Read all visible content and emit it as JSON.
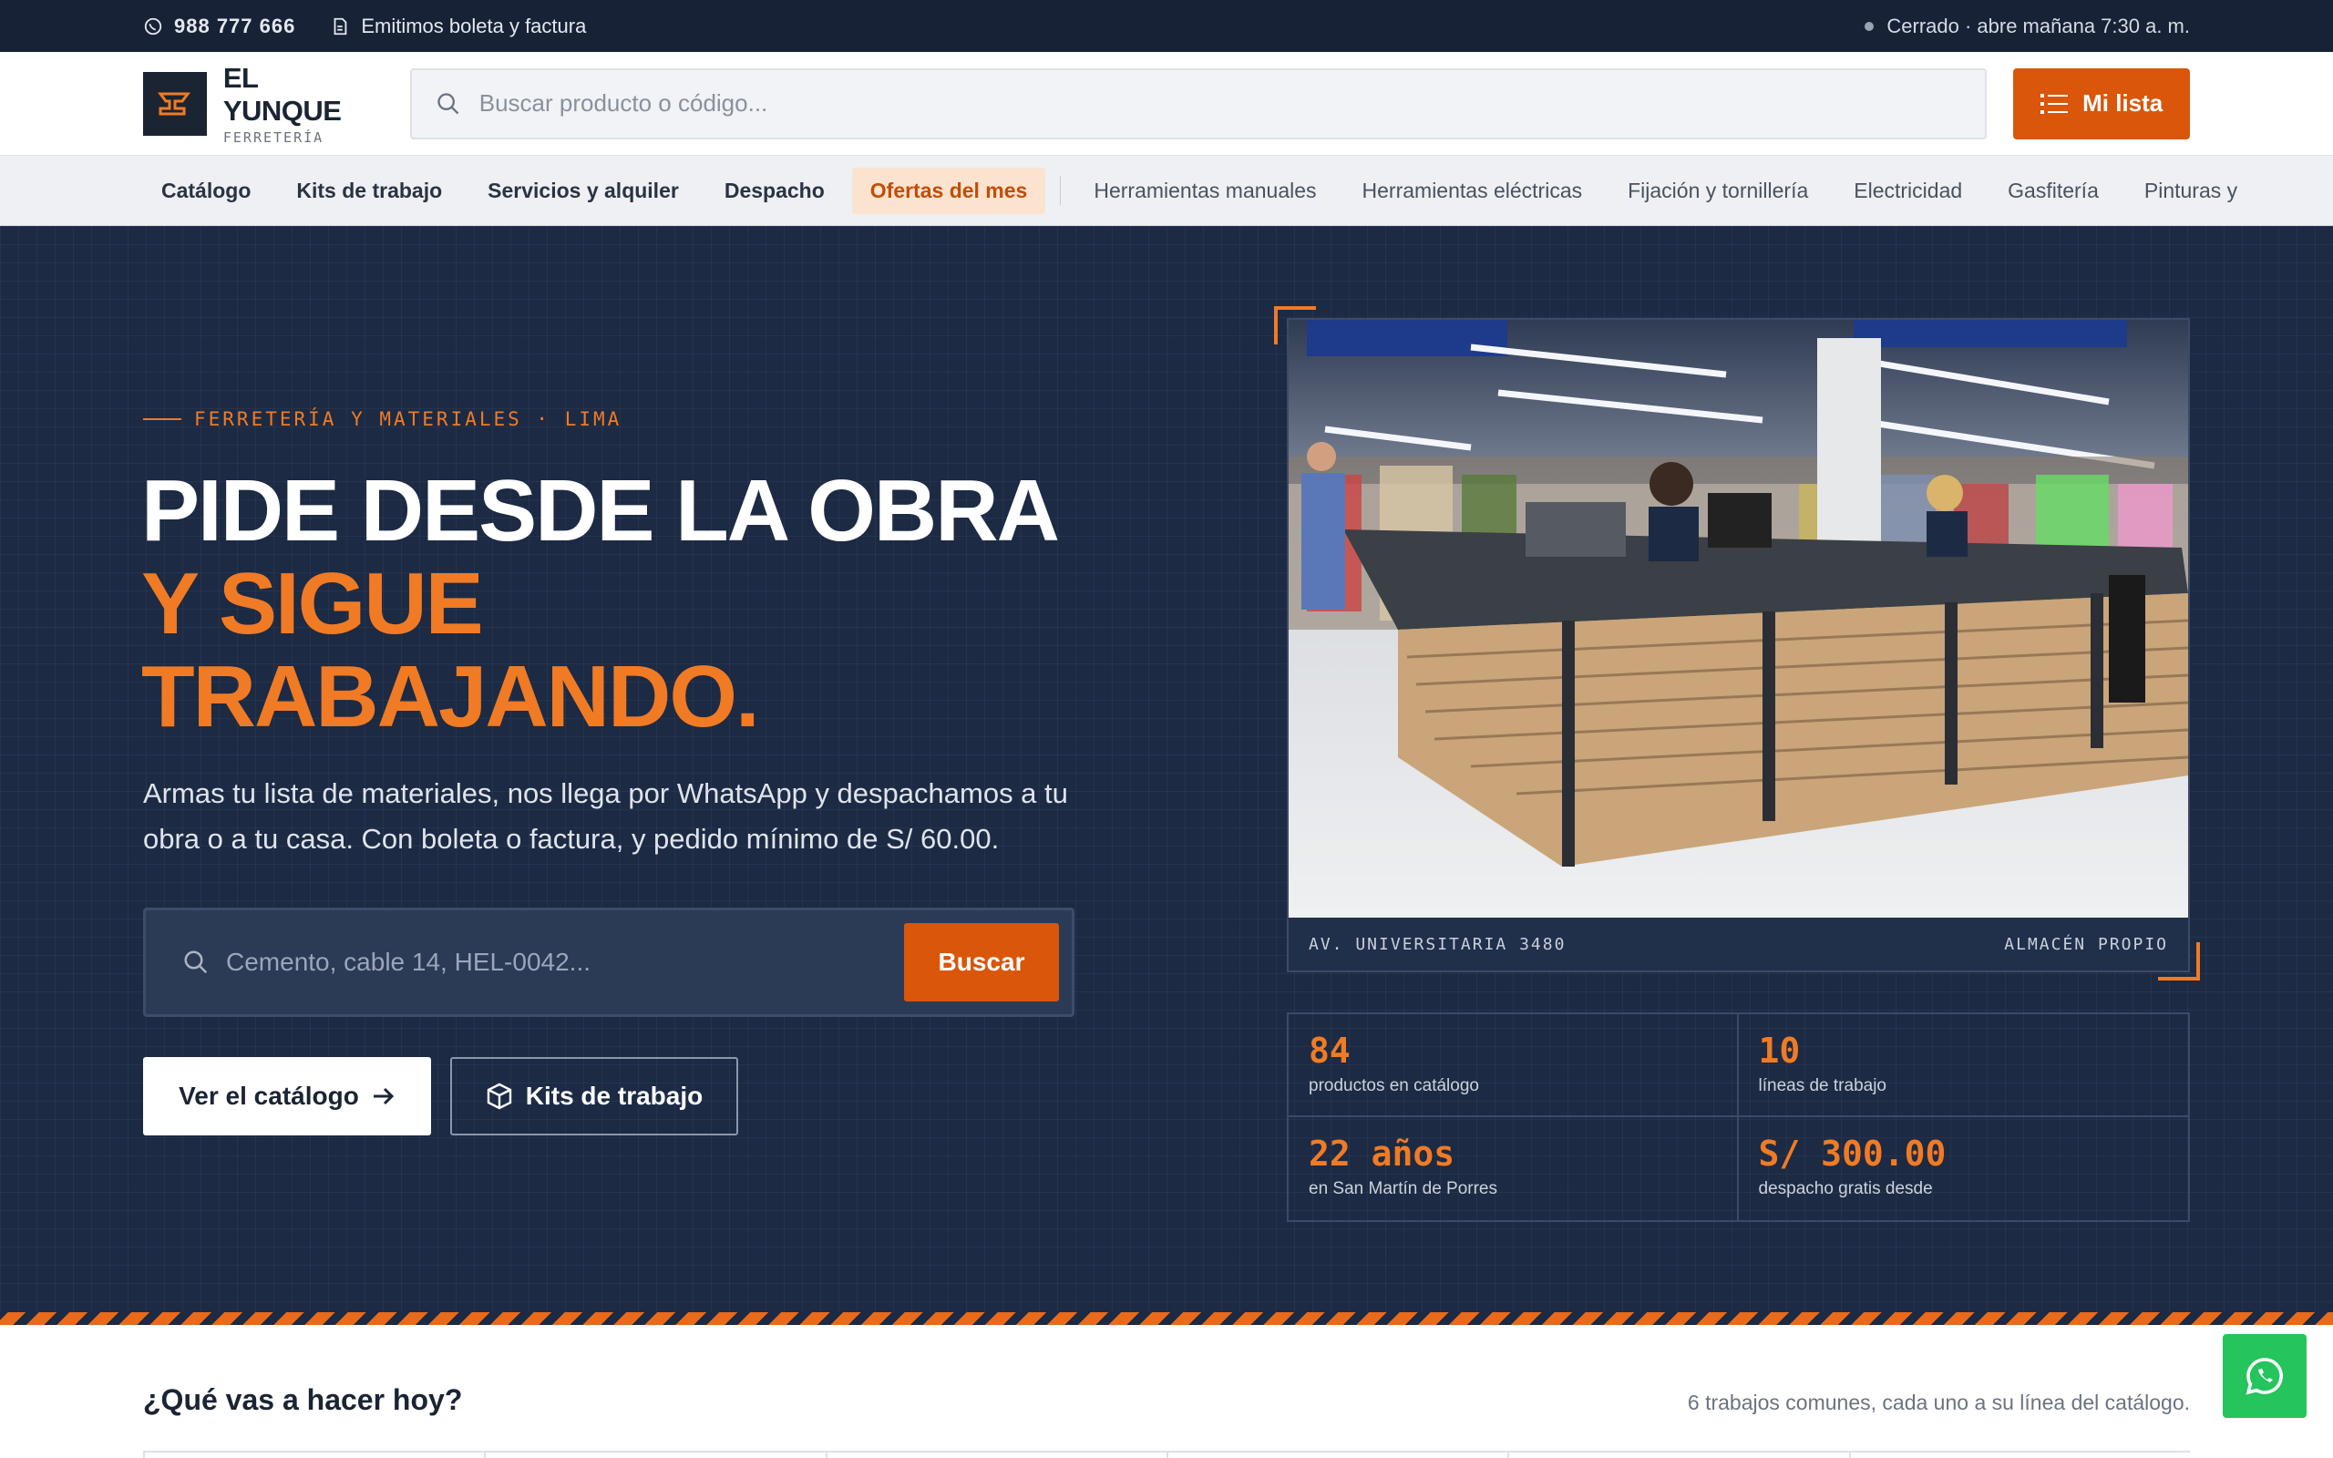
{
  "topbar": {
    "phone": "988 777 666",
    "invoice": "Emitimos boleta y factura",
    "status": "Cerrado · abre mañana 7:30 a. m."
  },
  "brand": {
    "name": "EL YUNQUE",
    "tagline": "FERRETERÍA",
    "accent": "#d9560b",
    "dark": "#1c2a44"
  },
  "header": {
    "search_placeholder": "Buscar producto o código...",
    "list_button": "Mi lista"
  },
  "nav": {
    "primary": [
      "Catálogo",
      "Kits de trabajo",
      "Servicios y alquiler",
      "Despacho"
    ],
    "offer": "Ofertas del mes",
    "categories": [
      "Herramientas manuales",
      "Herramientas eléctricas",
      "Fijación y tornillería",
      "Electricidad",
      "Gasfitería",
      "Pinturas y"
    ]
  },
  "hero": {
    "kicker": "FERRETERÍA Y MATERIALES · LIMA",
    "title_line1": "PIDE DESDE LA OBRA",
    "title_line2": "Y SIGUE",
    "title_line3": "TRABAJANDO.",
    "lead": "Armas tu lista de materiales, nos llega por WhatsApp y despachamos a tu obra o a tu casa. Con boleta o factura, y pedido mínimo de S/ 60.00.",
    "search_placeholder": "Cemento, cable 14, HEL-0042...",
    "search_button": "Buscar",
    "cta_catalog": "Ver el catálogo",
    "cta_kits": "Kits de trabajo",
    "photo_caption_left": "AV. UNIVERSITARIA 3480",
    "photo_caption_right": "ALMACÉN PROPIO"
  },
  "stats": [
    {
      "value": "84",
      "label": "productos en catálogo"
    },
    {
      "value": "10",
      "label": "líneas de trabajo"
    },
    {
      "value": "22 años",
      "label": "en San Martín de Porres"
    },
    {
      "value": "S/ 300.00",
      "label": "despacho gratis desde"
    }
  ],
  "section": {
    "title": "¿Qué vas a hacer hoy?",
    "subtitle": "6 trabajos comunes, cada uno a su línea del catálogo."
  }
}
